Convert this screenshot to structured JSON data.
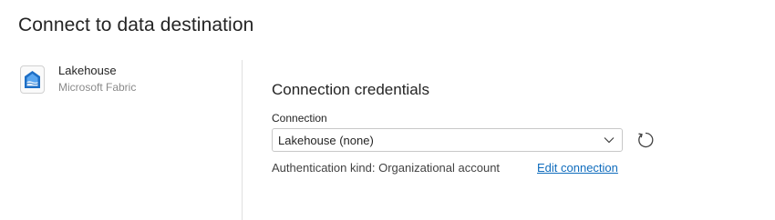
{
  "page": {
    "title": "Connect to data destination"
  },
  "destination": {
    "name": "Lakehouse",
    "provider": "Microsoft Fabric",
    "icon": "lakehouse-icon"
  },
  "credentials": {
    "section_title": "Connection credentials",
    "connection_label": "Connection",
    "connection_value": "Lakehouse (none)",
    "auth_kind_text": "Authentication kind: Organizational account",
    "edit_link_label": "Edit connection"
  },
  "colors": {
    "link": "#0f6cbd",
    "lakehouse_icon_blue": "#1e6fc6",
    "lakehouse_icon_light": "#5aa6f0"
  }
}
